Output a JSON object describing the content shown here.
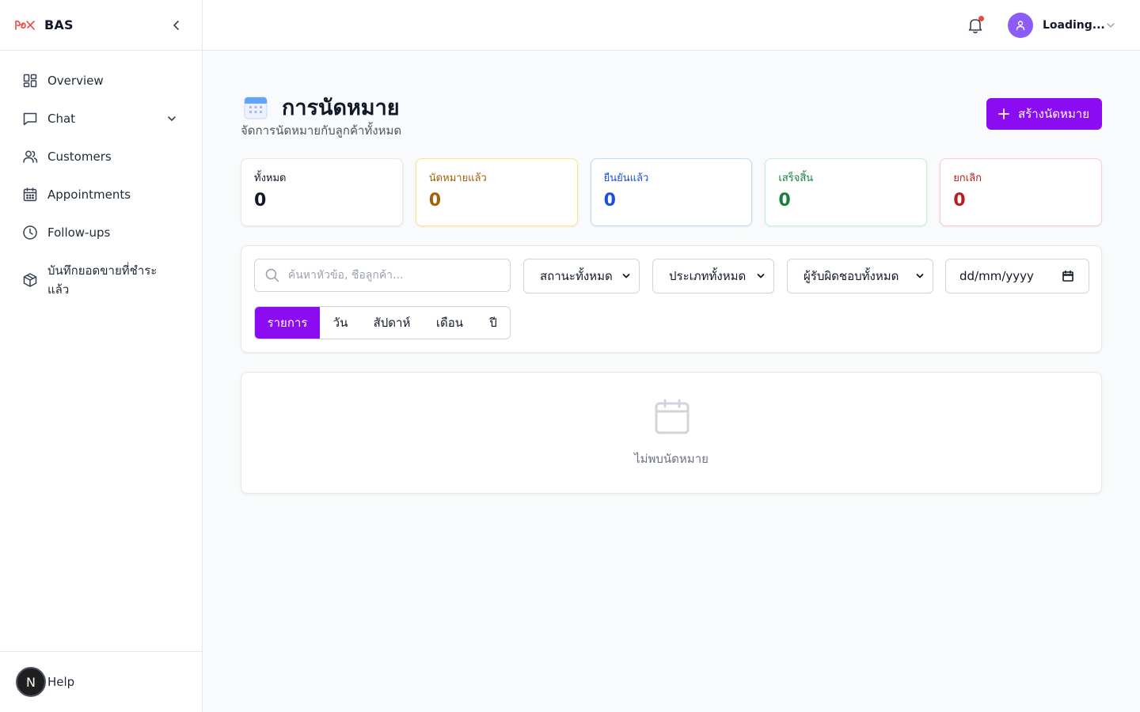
{
  "sidebar": {
    "brand": "BAS",
    "items": [
      {
        "label": "Overview",
        "icon": "dashboard-icon"
      },
      {
        "label": "Chat",
        "icon": "chat-icon"
      },
      {
        "label": "Customers",
        "icon": "users-icon"
      },
      {
        "label": "Appointments",
        "icon": "calendar-icon"
      },
      {
        "label": "Follow-ups",
        "icon": "clock-icon"
      },
      {
        "label": "บันทึกยอดขายที่ชำระแล้ว",
        "icon": "package-icon"
      }
    ],
    "help": {
      "avatar_letter": "N",
      "label": "Help"
    }
  },
  "topbar": {
    "user_name": "Loading...",
    "notification_dot_color": "#ef4444"
  },
  "page": {
    "title": "การนัดหมาย",
    "subtitle": "จัดการนัดหมายกับลูกค้าทั้งหมด",
    "create_button": "สร้างนัดหมาย"
  },
  "stats": [
    {
      "label": "ทั้งหมด",
      "value": "0",
      "color": "#111827",
      "border": "#e5e7eb"
    },
    {
      "label": "นัดหมายแล้ว",
      "value": "0",
      "color": "#a16207",
      "border": "#fde68a"
    },
    {
      "label": "ยืนยันแล้ว",
      "value": "0",
      "color": "#1d4ed8",
      "border": "#bfdbfe"
    },
    {
      "label": "เสร็จสิ้น",
      "value": "0",
      "color": "#15803d",
      "border": "#bbf7d0"
    },
    {
      "label": "ยกเลิก",
      "value": "0",
      "color": "#b91c1c",
      "border": "#fecaca"
    }
  ],
  "filters": {
    "search_placeholder": "ค้นหาหัวข้อ, ชื่อลูกค้า...",
    "status_select": "สถานะทั้งหมด",
    "type_select": "ประเภททั้งหมด",
    "assignee_select": "ผู้รับผิดชอบทั้งหมด",
    "date_placeholder": "dd/mm/yyyy"
  },
  "view_tabs": [
    {
      "label": "รายการ",
      "active": true
    },
    {
      "label": "วัน",
      "active": false
    },
    {
      "label": "สัปดาห์",
      "active": false
    },
    {
      "label": "เดือน",
      "active": false
    },
    {
      "label": "ปี",
      "active": false
    }
  ],
  "empty": {
    "text": "ไม่พบนัดหมาย"
  },
  "colors": {
    "accent": "#8b0cf0",
    "avatar": "#8b5cf6"
  }
}
